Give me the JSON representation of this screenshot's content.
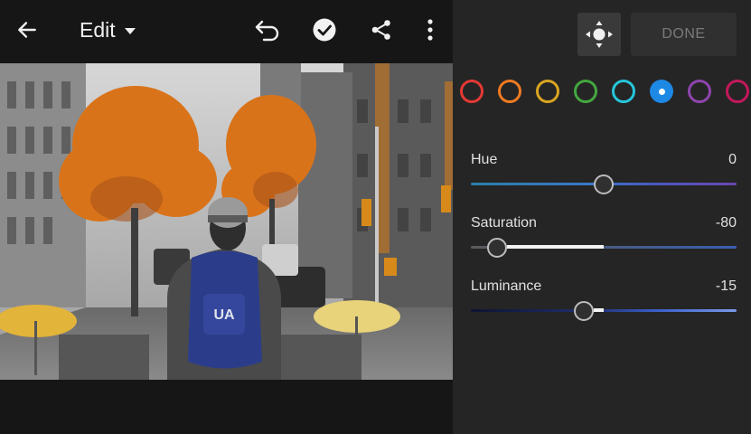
{
  "toolbar": {
    "title": "Edit",
    "icons": [
      "back-arrow-icon",
      "caret-down-icon",
      "undo-icon",
      "checkmark-circle-icon",
      "share-icon",
      "more-vertical-icon"
    ]
  },
  "panel": {
    "target_icon": "target-adjustment-icon",
    "done_label": "DONE",
    "swatches": [
      {
        "name": "red",
        "color": "#e53935"
      },
      {
        "name": "orange",
        "color": "#f07a22"
      },
      {
        "name": "yellow",
        "color": "#d9a521"
      },
      {
        "name": "green",
        "color": "#43a73f"
      },
      {
        "name": "aqua",
        "color": "#26c6da"
      },
      {
        "name": "blue",
        "color": "#1e88e5",
        "selected": true
      },
      {
        "name": "purple",
        "color": "#8e44ad"
      },
      {
        "name": "magenta",
        "color": "#c2185b"
      }
    ],
    "sliders": [
      {
        "label": "Hue",
        "value": "0",
        "position": 0.5
      },
      {
        "label": "Saturation",
        "value": "-80",
        "position": 0.1
      },
      {
        "label": "Luminance",
        "value": "-15",
        "position": 0.425
      }
    ]
  },
  "colors": {
    "accent": "#2196f3",
    "background": "#161616",
    "panel": "#252525"
  }
}
